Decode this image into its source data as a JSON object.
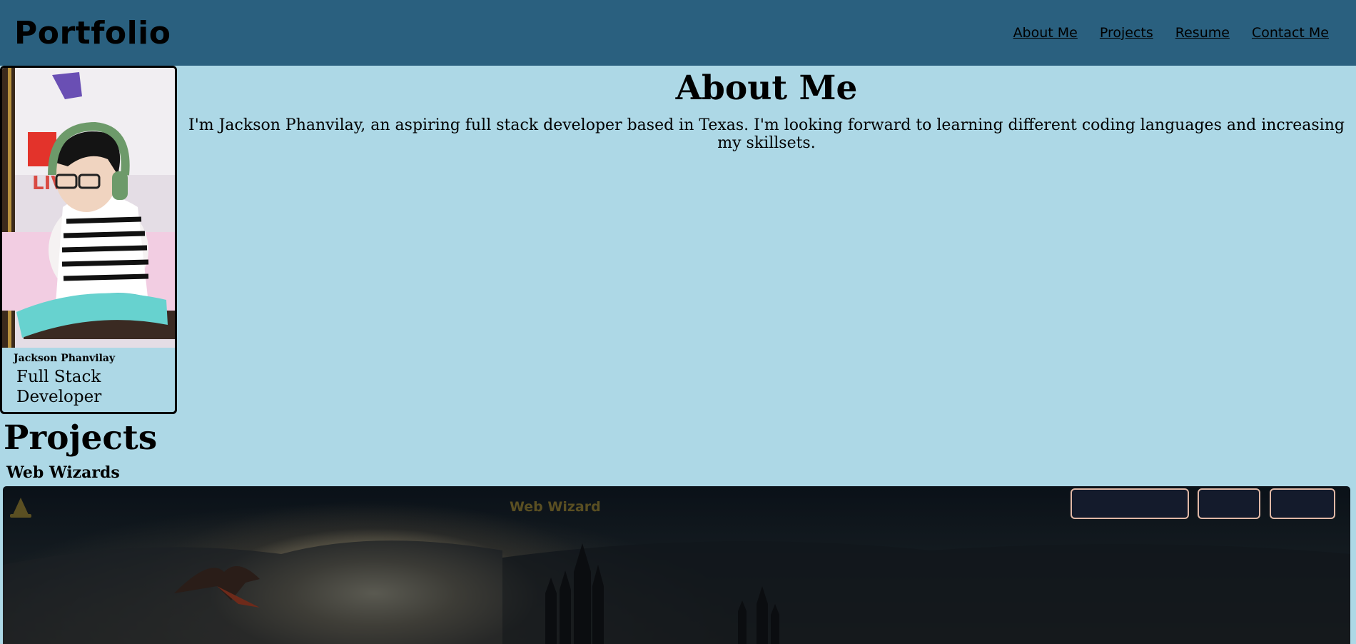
{
  "header": {
    "brand": "Portfolio",
    "nav": [
      "About Me",
      "Projects",
      "Resume",
      "Contact Me"
    ]
  },
  "profile": {
    "name": "Jackson Phanvilay",
    "role": "Full Stack Developer"
  },
  "about": {
    "title": "About Me",
    "text": "I'm Jackson Phanvilay, an aspiring full stack developer based in Texas. I'm looking forward to learning different coding languages and increasing my skillsets."
  },
  "projects": {
    "title": "Projects",
    "items": [
      {
        "name": "Web Wizards",
        "preview_title": "Web Wizard"
      }
    ]
  },
  "colors": {
    "header_bg": "#2a607f",
    "page_bg": "#add8e6",
    "preview_button_border": "#e0b8a6"
  }
}
